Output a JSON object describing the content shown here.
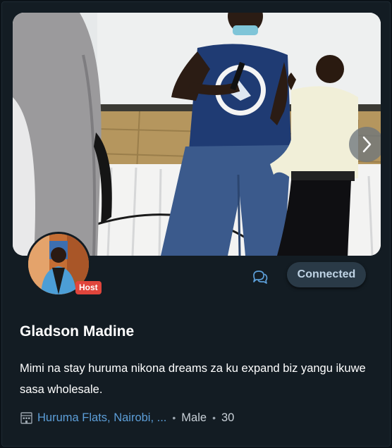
{
  "profile": {
    "name": "Gladson Madine",
    "role_badge": "Host",
    "bio": "Mimi na stay huruma nikona dreams za ku expand biz yangu ikuwe sasa wholesale.",
    "location": "Huruma Flats, Nairobi, ...",
    "gender": "Male",
    "age": "30",
    "separator": "•"
  },
  "actions": {
    "connect_label": "Connected",
    "message_icon": "chat-bubbles-icon",
    "next_icon": "chevron-right-icon"
  },
  "colors": {
    "card_bg": "#131c23",
    "page_bg": "#0b1218",
    "accent_link": "#5c9ed8",
    "badge_red": "#e0453c",
    "button_bg": "#2a3a47"
  }
}
